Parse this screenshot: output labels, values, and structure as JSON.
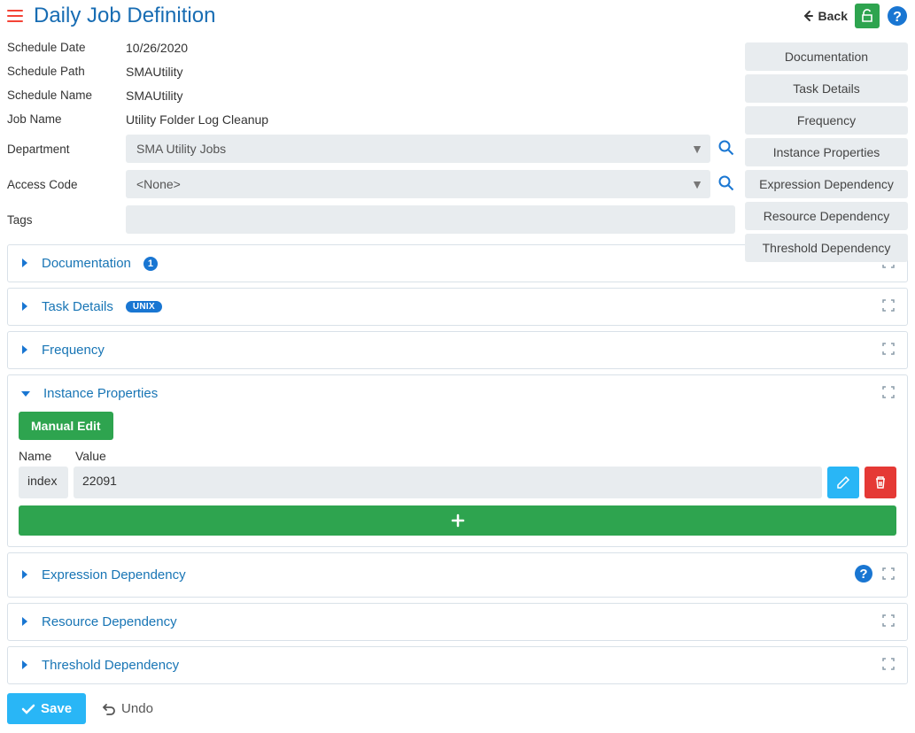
{
  "header": {
    "title": "Daily Job Definition",
    "back_label": "Back"
  },
  "form": {
    "schedule_date_label": "Schedule Date",
    "schedule_date_value": "10/26/2020",
    "schedule_path_label": "Schedule Path",
    "schedule_path_value": "SMAUtility",
    "schedule_name_label": "Schedule Name",
    "schedule_name_value": "SMAUtility",
    "job_name_label": "Job Name",
    "job_name_value": "Utility Folder Log Cleanup",
    "department_label": "Department",
    "department_value": "SMA Utility Jobs",
    "access_code_label": "Access Code",
    "access_code_value": "<None>",
    "tags_label": "Tags"
  },
  "right_nav": {
    "items": [
      "Documentation",
      "Task Details",
      "Frequency",
      "Instance Properties",
      "Expression Dependency",
      "Resource Dependency",
      "Threshold Dependency"
    ]
  },
  "panels": {
    "documentation": {
      "title": "Documentation",
      "badge_count": "1"
    },
    "task_details": {
      "title": "Task Details",
      "badge_text": "UNIX"
    },
    "frequency": {
      "title": "Frequency"
    },
    "instance_properties": {
      "title": "Instance Properties",
      "manual_edit_label": "Manual Edit",
      "col_name": "Name",
      "col_value": "Value",
      "rows": [
        {
          "name": "index",
          "value": "22091"
        }
      ]
    },
    "expression_dependency": {
      "title": "Expression Dependency"
    },
    "resource_dependency": {
      "title": "Resource Dependency"
    },
    "threshold_dependency": {
      "title": "Threshold Dependency"
    }
  },
  "footer": {
    "save_label": "Save",
    "undo_label": "Undo"
  }
}
